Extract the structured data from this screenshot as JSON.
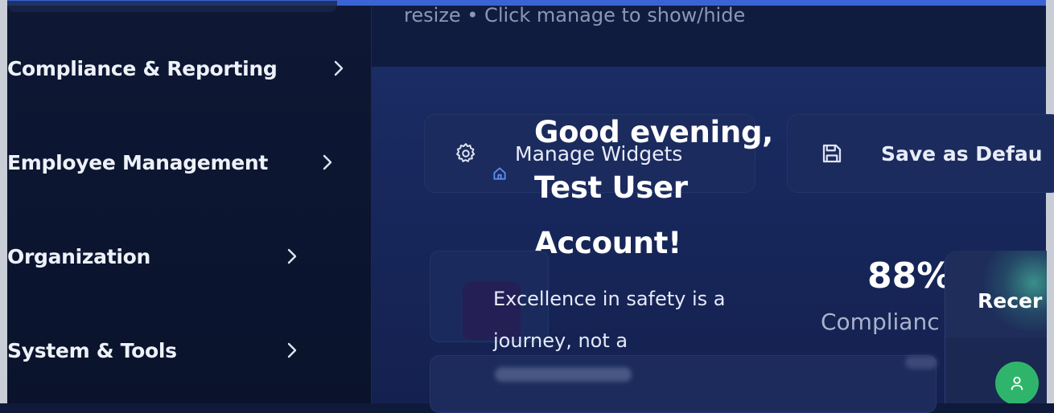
{
  "sidebar": {
    "items": [
      {
        "label": "Compliance & Reporting"
      },
      {
        "label": "Employee Management"
      },
      {
        "label": "Organization"
      },
      {
        "label": "System & Tools"
      }
    ]
  },
  "header": {
    "hint": "resize • Click manage to show/hide"
  },
  "toolbar": {
    "manage_label": "Manage Widgets",
    "save_label": "Save as Defau"
  },
  "welcome": {
    "greeting": "Good evening, Test User Account!",
    "quote": "Excellence in safety is a journey, not a"
  },
  "stats": {
    "compliance_value": "88%",
    "compliance_label": "Complianc"
  },
  "recent": {
    "title": "Recer"
  },
  "icons": {
    "chevron": "chevron-right-icon",
    "gear": "gear-icon",
    "save": "save-icon",
    "home": "home-icon",
    "user": "user-icon"
  },
  "colors": {
    "accent_bar": "#3a64d6",
    "avatar_green": "#2fb56b",
    "sidebar_bg": "#0e1834",
    "panel_bg": "#1a2c64"
  }
}
